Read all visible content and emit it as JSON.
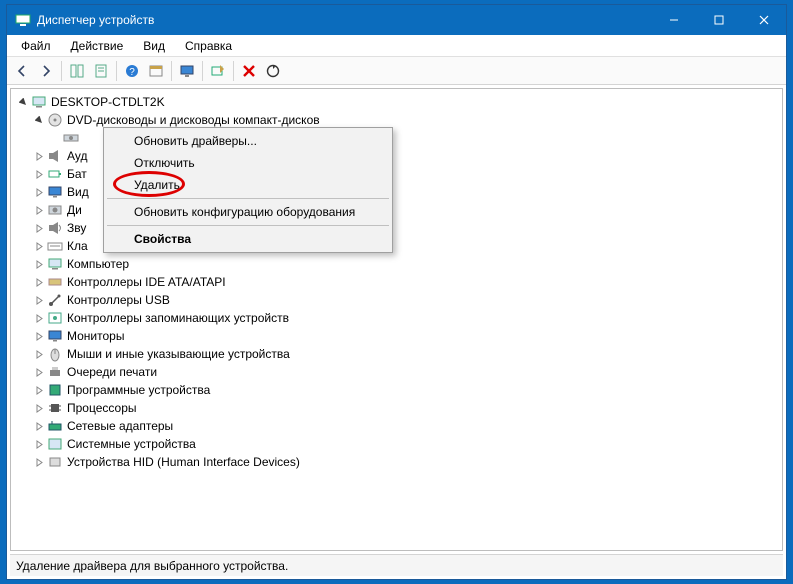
{
  "title": "Диспетчер устройств",
  "menubar": [
    "Файл",
    "Действие",
    "Вид",
    "Справка"
  ],
  "toolbar_icons": [
    "back",
    "forward",
    "container-up",
    "refresh-all",
    "help",
    "properties",
    "show-hidden",
    "scan",
    "delete",
    "refresh-circle"
  ],
  "tree": {
    "root": {
      "label": "DESKTOP-CTDLT2K",
      "expanded": true
    },
    "dvd_group": {
      "label": "DVD-дисководы и дисководы компакт-дисков",
      "expanded": true
    },
    "categories": [
      {
        "key": "audio",
        "label": "Ауд",
        "icon": "speaker"
      },
      {
        "key": "battery",
        "label": "Бат",
        "icon": "battery"
      },
      {
        "key": "video",
        "label": "Вид",
        "icon": "display"
      },
      {
        "key": "disk",
        "label": "Ди",
        "icon": "disk"
      },
      {
        "key": "sound",
        "label": "Зву",
        "icon": "sound"
      },
      {
        "key": "keyboard",
        "label": "Кла",
        "icon": "keyboard"
      },
      {
        "key": "computer",
        "label": "Компьютер",
        "icon": "computer"
      },
      {
        "key": "ide",
        "label": "Контроллеры IDE ATA/ATAPI",
        "icon": "ide"
      },
      {
        "key": "usb",
        "label": "Контроллеры USB",
        "icon": "usb"
      },
      {
        "key": "storage",
        "label": "Контроллеры запоминающих устройств",
        "icon": "storage"
      },
      {
        "key": "monitor",
        "label": "Мониторы",
        "icon": "monitor"
      },
      {
        "key": "mouse",
        "label": "Мыши и иные указывающие устройства",
        "icon": "mouse"
      },
      {
        "key": "printq",
        "label": "Очереди печати",
        "icon": "printer"
      },
      {
        "key": "software",
        "label": "Программные устройства",
        "icon": "software"
      },
      {
        "key": "cpu",
        "label": "Процессоры",
        "icon": "cpu"
      },
      {
        "key": "network",
        "label": "Сетевые адаптеры",
        "icon": "network"
      },
      {
        "key": "system",
        "label": "Системные устройства",
        "icon": "system"
      },
      {
        "key": "hid",
        "label": "Устройства HID (Human Interface Devices)",
        "icon": "hid"
      }
    ]
  },
  "context_menu": {
    "items": [
      {
        "label": "Обновить драйверы...",
        "type": "item"
      },
      {
        "label": "Отключить",
        "type": "item"
      },
      {
        "label": "Удалить",
        "type": "item",
        "highlight": true
      },
      {
        "type": "sep"
      },
      {
        "label": "Обновить конфигурацию оборудования",
        "type": "item"
      },
      {
        "type": "sep"
      },
      {
        "label": "Свойства",
        "type": "item",
        "bold": true
      }
    ]
  },
  "statusbar": "Удаление драйвера для выбранного устройства.",
  "accent": "#0b6cbd"
}
